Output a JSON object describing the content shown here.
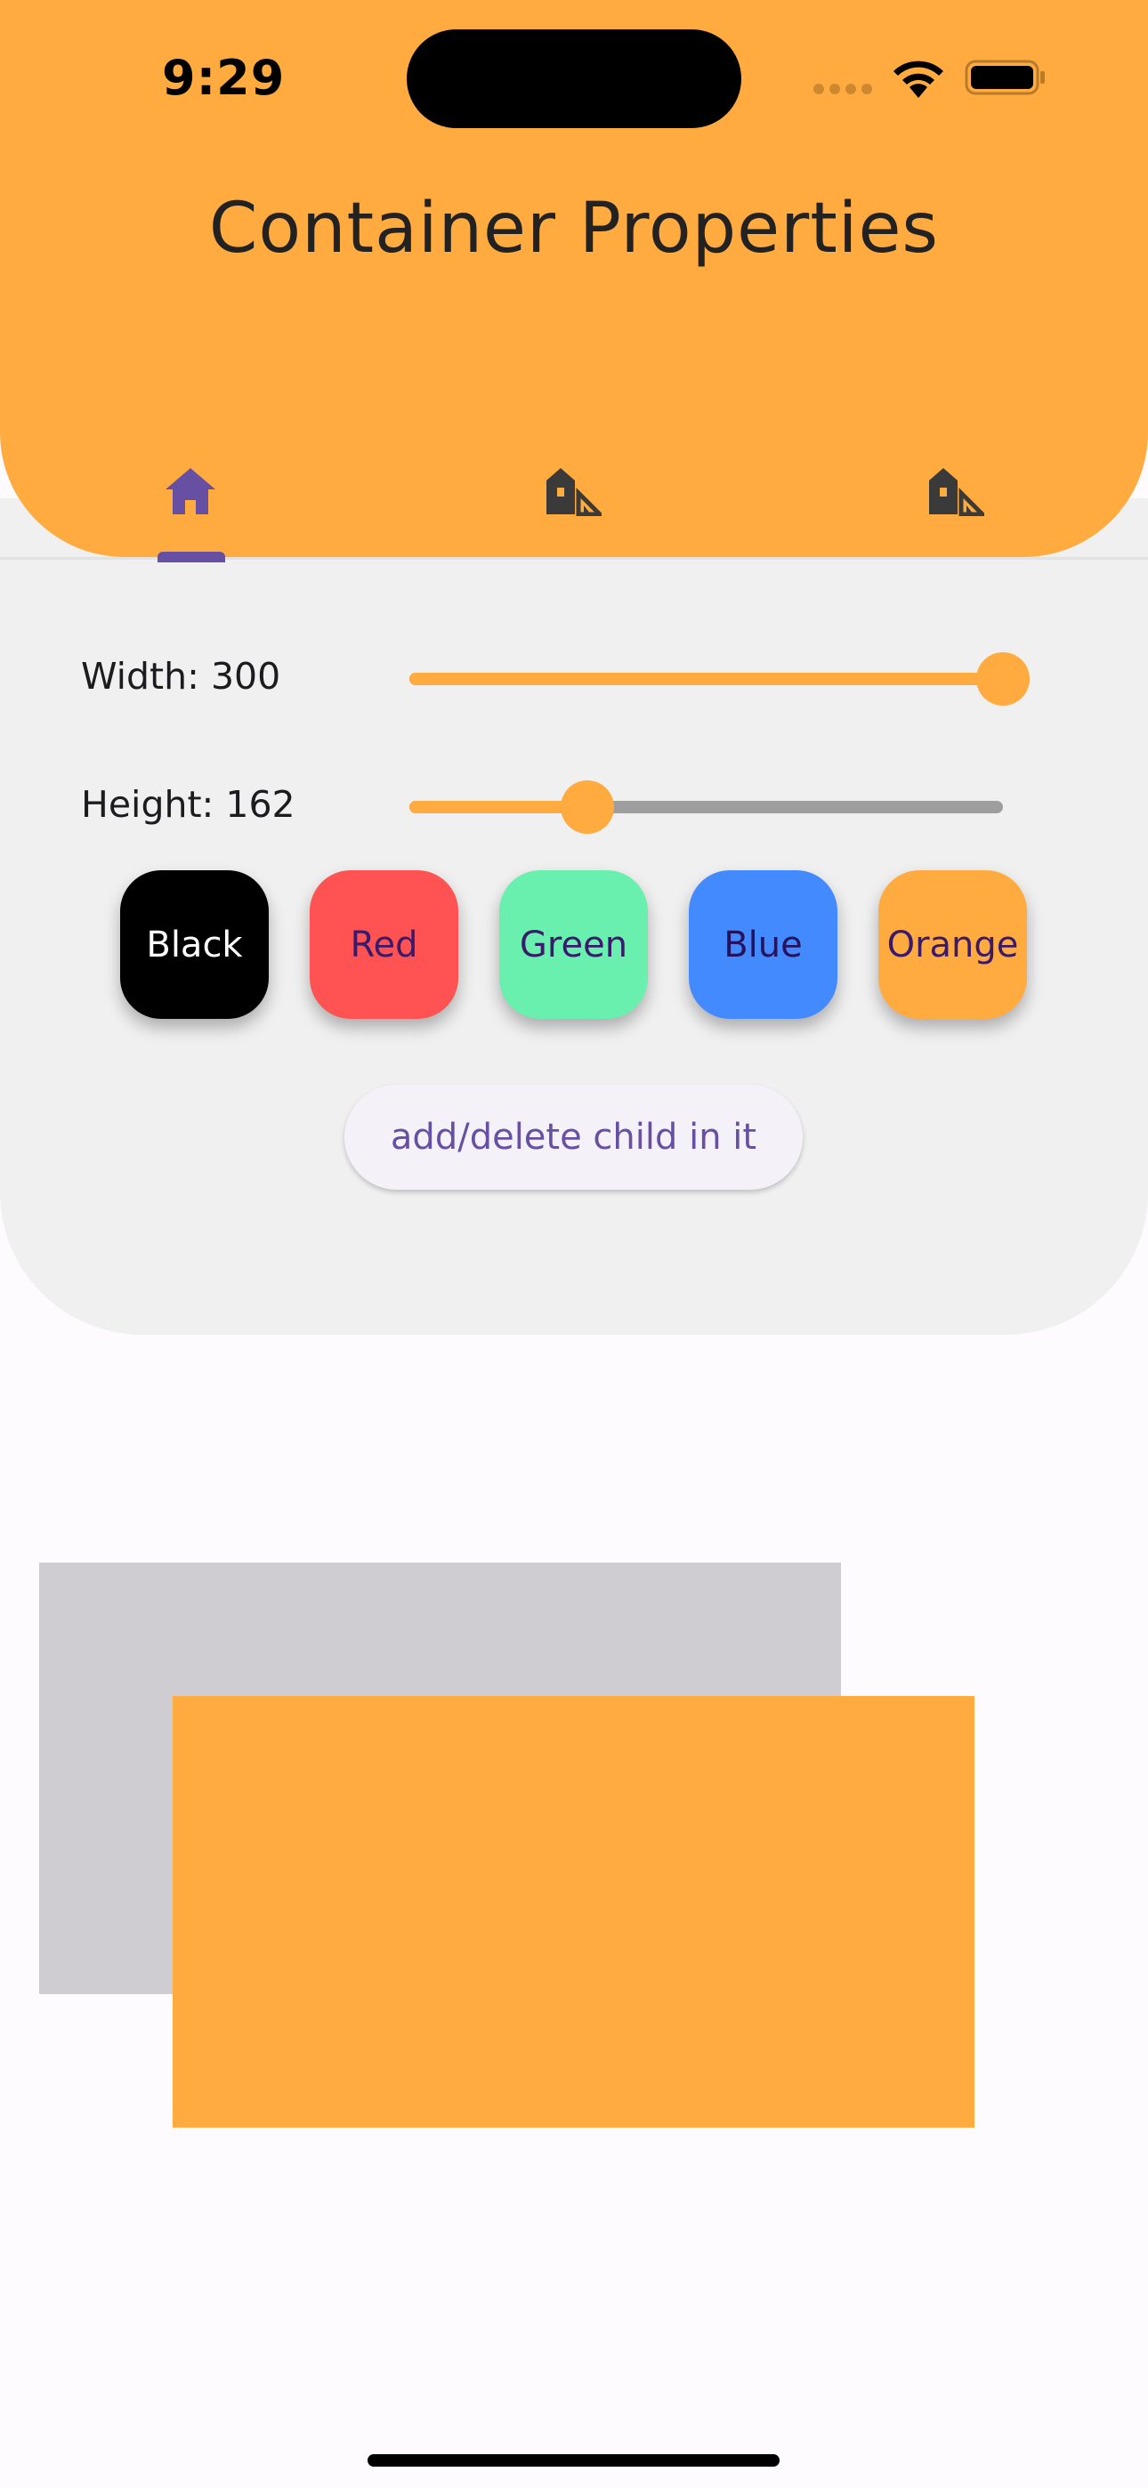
{
  "status_bar": {
    "time": "9:29"
  },
  "app_bar": {
    "title": "Container Properties",
    "tabs": [
      {
        "icon": "home-icon",
        "selected": true
      },
      {
        "icon": "house-siding-icon",
        "selected": false
      },
      {
        "icon": "house-siding-icon",
        "selected": false
      }
    ]
  },
  "controls": {
    "width_label": "Width: 300",
    "width_fraction": 1.0,
    "height_label": "Height: 162",
    "height_fraction": 0.3,
    "color_buttons": [
      {
        "label": "Black",
        "color": "#000000"
      },
      {
        "label": "Red",
        "color": "#ff5252"
      },
      {
        "label": "Green",
        "color": "#69f0ae"
      },
      {
        "label": "Blue",
        "color": "#448aff"
      },
      {
        "label": "Orange",
        "color": "#ffab40"
      }
    ],
    "child_button_label": "add/delete child in it"
  },
  "colors": {
    "accent": "#ffab40",
    "primary": "#6750a4",
    "back_container": "#cfcdd1",
    "front_container": "#ffab40"
  }
}
